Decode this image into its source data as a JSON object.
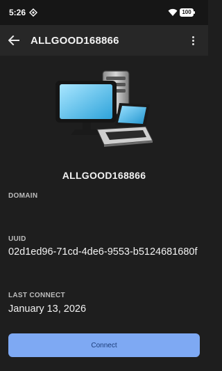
{
  "status_bar": {
    "time": "5:26",
    "sim_icon": "sim-card-icon",
    "wifi_icon": "wifi-icon",
    "battery_level": "100"
  },
  "app_bar": {
    "back_icon": "arrow-back-icon",
    "title": "ALLGOOD168866",
    "overflow_icon": "more-vert-icon"
  },
  "illustration": "desktop-and-laptop-icon",
  "device": {
    "name": "ALLGOOD168866"
  },
  "fields": {
    "domain": {
      "label": "DOMAIN",
      "value": ""
    },
    "uuid": {
      "label": "UUID",
      "value": "02d1ed96-71cd-4de6-9553-b5124681680f"
    },
    "last_connect": {
      "label": "LAST CONNECT",
      "value": "January 13, 2026"
    }
  },
  "actions": {
    "connect_label": "Connect"
  },
  "colors": {
    "background": "#1e1e1e",
    "app_bar": "#272727",
    "accent": "#7ea9f3",
    "accent_text": "#1c3d7a"
  }
}
